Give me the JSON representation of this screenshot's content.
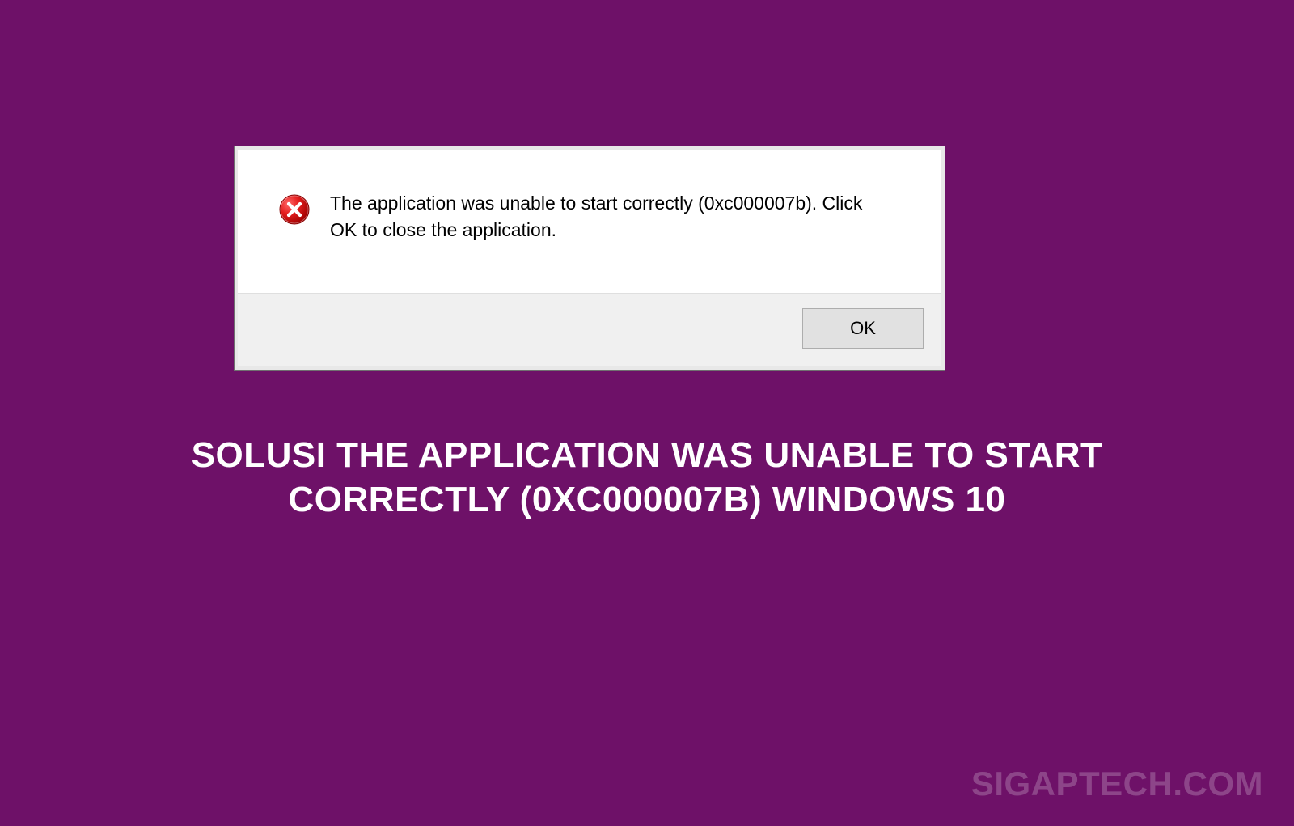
{
  "dialog": {
    "message": "The application was unable to start correctly (0xc000007b). Click OK to close the application.",
    "ok_label": "OK"
  },
  "headline": "SOLUSI THE APPLICATION WAS UNABLE TO START CORRECTLY (0XC000007B) WINDOWS 10",
  "watermark": "SIGAPTECH.COM"
}
